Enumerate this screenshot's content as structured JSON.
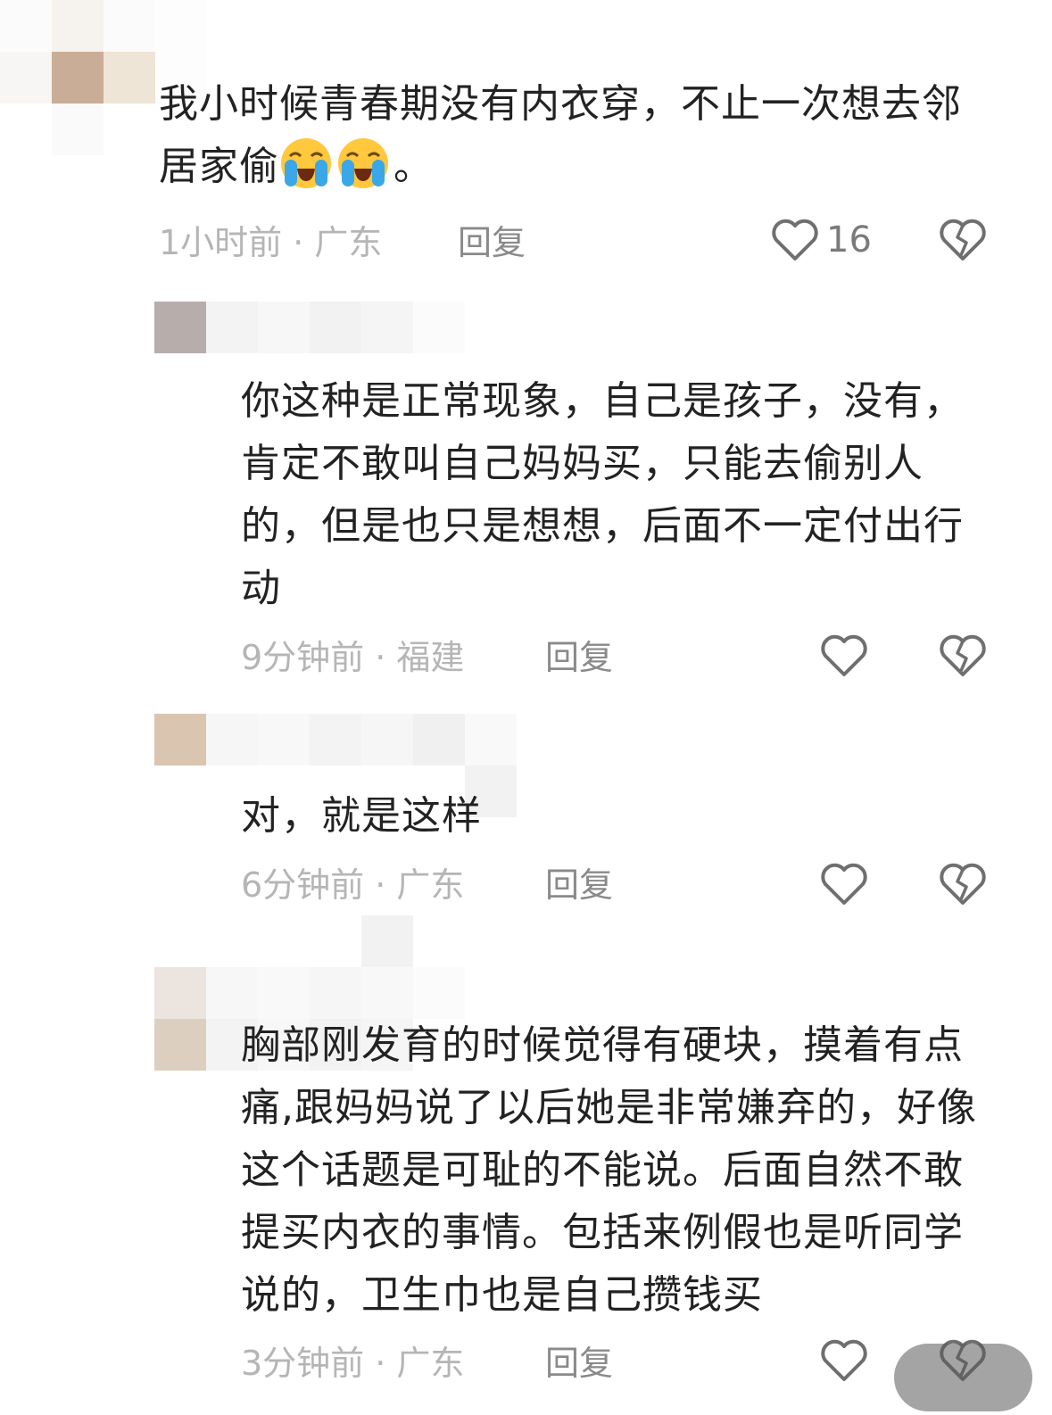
{
  "comments": [
    {
      "text": "我小时候青春期没有内衣穿，不止一次想去邻居家偷",
      "text_end": "。",
      "emoji": [
        "loudly-crying-face",
        "loudly-crying-face"
      ],
      "meta": "1小时前 · 广东",
      "reply_label": "回复",
      "like_count": "16"
    },
    {
      "text": "你这种是正常现象，自己是孩子，没有，肯定不敢叫自己妈妈买，只能去偷别人的，但是也只是想想，后面不一定付出行动",
      "meta": "9分钟前 · 福建",
      "reply_label": "回复"
    },
    {
      "text": "对，就是这样",
      "meta": "6分钟前 · 广东",
      "reply_label": "回复"
    },
    {
      "text": "胸部刚发育的时候觉得有硬块，摸着有点痛,跟妈妈说了以后她是非常嫌弃的，好像这个话题是可耻的不能说。后面自然不敢提买内衣的事情。包括来例假也是听同学说的，卫生巾也是自己攒钱买",
      "meta": "3分钟前 · 广东",
      "reply_label": "回复"
    }
  ],
  "icons": {
    "like": "heart-outline-icon",
    "dislike": "broken-heart-icon"
  },
  "colors": {
    "text": "#222222",
    "meta": "#b5b5b5",
    "reply": "#8a8a8a",
    "icon": "#6f6f6f"
  }
}
